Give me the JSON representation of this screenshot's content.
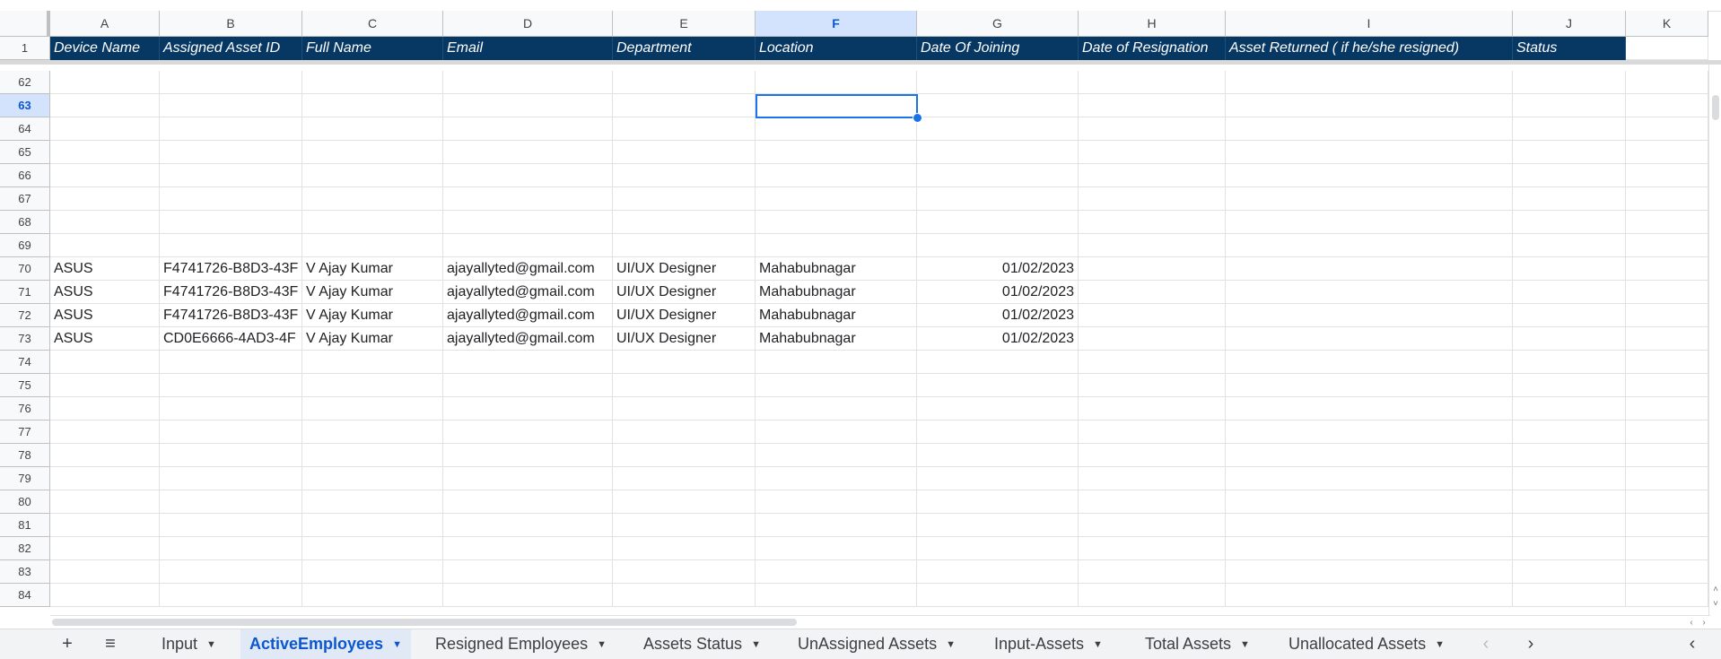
{
  "columns": [
    "A",
    "B",
    "C",
    "D",
    "E",
    "F",
    "G",
    "H",
    "I",
    "J",
    "K"
  ],
  "selected_column": "F",
  "header_row_number": "1",
  "headers": [
    "Device Name",
    "Assigned Asset ID",
    "Full Name",
    "Email",
    "Department",
    "Location",
    "Date Of Joining",
    "Date of Resignation",
    "Asset Returned ( if he/she resigned)",
    "Status"
  ],
  "selected_row": "63",
  "rows": [
    {
      "num": "62",
      "cells": [
        "",
        "",
        "",
        "",
        "",
        "",
        "",
        "",
        "",
        ""
      ]
    },
    {
      "num": "63",
      "cells": [
        "",
        "",
        "",
        "",
        "",
        "",
        "",
        "",
        "",
        ""
      ]
    },
    {
      "num": "64",
      "cells": [
        "",
        "",
        "",
        "",
        "",
        "",
        "",
        "",
        "",
        ""
      ]
    },
    {
      "num": "65",
      "cells": [
        "",
        "",
        "",
        "",
        "",
        "",
        "",
        "",
        "",
        ""
      ]
    },
    {
      "num": "66",
      "cells": [
        "",
        "",
        "",
        "",
        "",
        "",
        "",
        "",
        "",
        ""
      ]
    },
    {
      "num": "67",
      "cells": [
        "",
        "",
        "",
        "",
        "",
        "",
        "",
        "",
        "",
        ""
      ]
    },
    {
      "num": "68",
      "cells": [
        "",
        "",
        "",
        "",
        "",
        "",
        "",
        "",
        "",
        ""
      ]
    },
    {
      "num": "69",
      "cells": [
        "",
        "",
        "",
        "",
        "",
        "",
        "",
        "",
        "",
        ""
      ]
    },
    {
      "num": "70",
      "cells": [
        "ASUS",
        "F4741726-B8D3-43F",
        "V Ajay Kumar",
        "ajayallyted@gmail.com",
        "UI/UX Designer",
        "Mahabubnagar",
        "01/02/2023",
        "",
        "",
        ""
      ]
    },
    {
      "num": "71",
      "cells": [
        "ASUS",
        "F4741726-B8D3-43F",
        "V Ajay Kumar",
        "ajayallyted@gmail.com",
        "UI/UX Designer",
        "Mahabubnagar",
        "01/02/2023",
        "",
        "",
        ""
      ]
    },
    {
      "num": "72",
      "cells": [
        "ASUS",
        "F4741726-B8D3-43F",
        "V Ajay Kumar",
        "ajayallyted@gmail.com",
        "UI/UX Designer",
        "Mahabubnagar",
        "01/02/2023",
        "",
        "",
        ""
      ]
    },
    {
      "num": "73",
      "cells": [
        "ASUS",
        "CD0E6666-4AD3-4F",
        "V Ajay Kumar",
        "ajayallyted@gmail.com",
        "UI/UX Designer",
        "Mahabubnagar",
        "01/02/2023",
        "",
        "",
        ""
      ]
    },
    {
      "num": "74",
      "cells": [
        "",
        "",
        "",
        "",
        "",
        "",
        "",
        "",
        "",
        ""
      ]
    },
    {
      "num": "75",
      "cells": [
        "",
        "",
        "",
        "",
        "",
        "",
        "",
        "",
        "",
        ""
      ]
    },
    {
      "num": "76",
      "cells": [
        "",
        "",
        "",
        "",
        "",
        "",
        "",
        "",
        "",
        ""
      ]
    },
    {
      "num": "77",
      "cells": [
        "",
        "",
        "",
        "",
        "",
        "",
        "",
        "",
        "",
        ""
      ]
    },
    {
      "num": "78",
      "cells": [
        "",
        "",
        "",
        "",
        "",
        "",
        "",
        "",
        "",
        ""
      ]
    },
    {
      "num": "79",
      "cells": [
        "",
        "",
        "",
        "",
        "",
        "",
        "",
        "",
        "",
        ""
      ]
    },
    {
      "num": "80",
      "cells": [
        "",
        "",
        "",
        "",
        "",
        "",
        "",
        "",
        "",
        ""
      ]
    },
    {
      "num": "81",
      "cells": [
        "",
        "",
        "",
        "",
        "",
        "",
        "",
        "",
        "",
        ""
      ]
    },
    {
      "num": "82",
      "cells": [
        "",
        "",
        "",
        "",
        "",
        "",
        "",
        "",
        "",
        ""
      ]
    },
    {
      "num": "83",
      "cells": [
        "",
        "",
        "",
        "",
        "",
        "",
        "",
        "",
        "",
        ""
      ]
    },
    {
      "num": "84",
      "cells": [
        "",
        "",
        "",
        "",
        "",
        "",
        "",
        "",
        "",
        ""
      ]
    }
  ],
  "tabs": [
    {
      "label": "Input",
      "active": false
    },
    {
      "label": "ActiveEmployees",
      "active": true
    },
    {
      "label": "Resigned Employees",
      "active": false
    },
    {
      "label": "Assets Status",
      "active": false
    },
    {
      "label": "UnAssigned Assets",
      "active": false
    },
    {
      "label": "Input-Assets",
      "active": false
    },
    {
      "label": "Total Assets",
      "active": false
    },
    {
      "label": "Unallocated Assets",
      "active": false
    }
  ],
  "icons": {
    "add_sheet": "plus-icon",
    "all_sheets": "menu-icon",
    "tab_dropdown": "caret-down-icon",
    "prev": "chevron-left-icon",
    "next": "chevron-right-icon",
    "collapse": "chevron-left-icon"
  },
  "colors": {
    "header_bg": "#073763",
    "header_text": "#ffffff",
    "selection": "#1a73e8",
    "active_tab_text": "#0b57d0"
  }
}
